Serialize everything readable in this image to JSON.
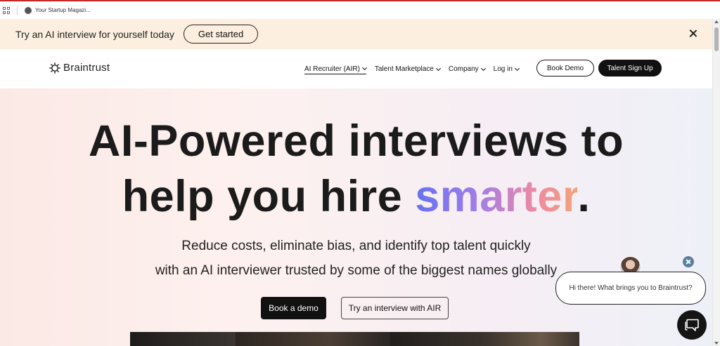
{
  "browser": {
    "tab_title": "Your Startup Magazi..."
  },
  "promo": {
    "text": "Try an AI interview for yourself today",
    "button": "Get started"
  },
  "header": {
    "logo": "Braintrust",
    "nav": [
      {
        "label": "AI Recruiter (AIR)",
        "active": true
      },
      {
        "label": "Talent Marketplace",
        "active": false
      },
      {
        "label": "Company",
        "active": false
      },
      {
        "label": "Log in",
        "active": false
      }
    ],
    "book_demo": "Book Demo",
    "talent_signup": "Talent Sign Up"
  },
  "hero": {
    "line1": "AI-Powered interviews to",
    "line2_prefix": "help you hire ",
    "line2_accent": "smarter",
    "line2_suffix": ".",
    "sub1": "Reduce costs, eliminate bias, and identify top talent quickly",
    "sub2": "with an AI interviewer trusted by some of the biggest names globally",
    "cta_primary": "Book a demo",
    "cta_secondary": "Try an interview with AIR"
  },
  "chat": {
    "message": "Hi there! What brings you to Braintrust?"
  },
  "colors": {
    "accent_gradient": [
      "#6672f0",
      "#a37ee6",
      "#ef8aa1",
      "#f2a37a"
    ],
    "promo_bg": "#fcefdf",
    "dark": "#111111"
  }
}
